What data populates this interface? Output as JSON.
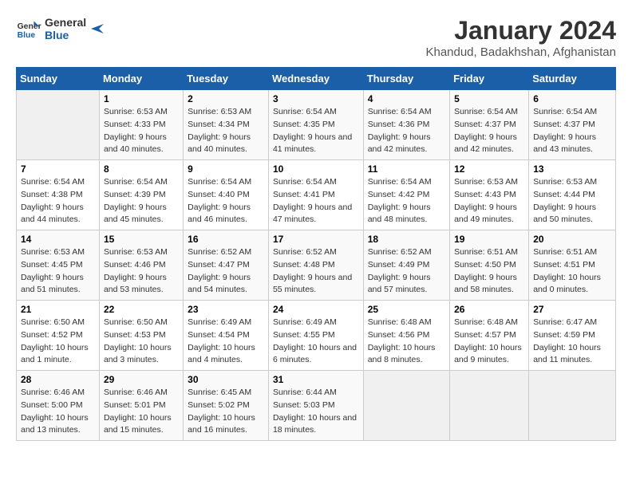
{
  "header": {
    "logo_line1": "General",
    "logo_line2": "Blue",
    "title": "January 2024",
    "subtitle": "Khandud, Badakhshan, Afghanistan"
  },
  "days_of_week": [
    "Sunday",
    "Monday",
    "Tuesday",
    "Wednesday",
    "Thursday",
    "Friday",
    "Saturday"
  ],
  "weeks": [
    [
      {
        "num": "",
        "empty": true
      },
      {
        "num": "1",
        "sunrise": "6:53 AM",
        "sunset": "4:33 PM",
        "daylight": "9 hours and 40 minutes."
      },
      {
        "num": "2",
        "sunrise": "6:53 AM",
        "sunset": "4:34 PM",
        "daylight": "9 hours and 40 minutes."
      },
      {
        "num": "3",
        "sunrise": "6:54 AM",
        "sunset": "4:35 PM",
        "daylight": "9 hours and 41 minutes."
      },
      {
        "num": "4",
        "sunrise": "6:54 AM",
        "sunset": "4:36 PM",
        "daylight": "9 hours and 42 minutes."
      },
      {
        "num": "5",
        "sunrise": "6:54 AM",
        "sunset": "4:37 PM",
        "daylight": "9 hours and 42 minutes."
      },
      {
        "num": "6",
        "sunrise": "6:54 AM",
        "sunset": "4:37 PM",
        "daylight": "9 hours and 43 minutes."
      }
    ],
    [
      {
        "num": "7",
        "sunrise": "6:54 AM",
        "sunset": "4:38 PM",
        "daylight": "9 hours and 44 minutes."
      },
      {
        "num": "8",
        "sunrise": "6:54 AM",
        "sunset": "4:39 PM",
        "daylight": "9 hours and 45 minutes."
      },
      {
        "num": "9",
        "sunrise": "6:54 AM",
        "sunset": "4:40 PM",
        "daylight": "9 hours and 46 minutes."
      },
      {
        "num": "10",
        "sunrise": "6:54 AM",
        "sunset": "4:41 PM",
        "daylight": "9 hours and 47 minutes."
      },
      {
        "num": "11",
        "sunrise": "6:54 AM",
        "sunset": "4:42 PM",
        "daylight": "9 hours and 48 minutes."
      },
      {
        "num": "12",
        "sunrise": "6:53 AM",
        "sunset": "4:43 PM",
        "daylight": "9 hours and 49 minutes."
      },
      {
        "num": "13",
        "sunrise": "6:53 AM",
        "sunset": "4:44 PM",
        "daylight": "9 hours and 50 minutes."
      }
    ],
    [
      {
        "num": "14",
        "sunrise": "6:53 AM",
        "sunset": "4:45 PM",
        "daylight": "9 hours and 51 minutes."
      },
      {
        "num": "15",
        "sunrise": "6:53 AM",
        "sunset": "4:46 PM",
        "daylight": "9 hours and 53 minutes."
      },
      {
        "num": "16",
        "sunrise": "6:52 AM",
        "sunset": "4:47 PM",
        "daylight": "9 hours and 54 minutes."
      },
      {
        "num": "17",
        "sunrise": "6:52 AM",
        "sunset": "4:48 PM",
        "daylight": "9 hours and 55 minutes."
      },
      {
        "num": "18",
        "sunrise": "6:52 AM",
        "sunset": "4:49 PM",
        "daylight": "9 hours and 57 minutes."
      },
      {
        "num": "19",
        "sunrise": "6:51 AM",
        "sunset": "4:50 PM",
        "daylight": "9 hours and 58 minutes."
      },
      {
        "num": "20",
        "sunrise": "6:51 AM",
        "sunset": "4:51 PM",
        "daylight": "10 hours and 0 minutes."
      }
    ],
    [
      {
        "num": "21",
        "sunrise": "6:50 AM",
        "sunset": "4:52 PM",
        "daylight": "10 hours and 1 minute."
      },
      {
        "num": "22",
        "sunrise": "6:50 AM",
        "sunset": "4:53 PM",
        "daylight": "10 hours and 3 minutes."
      },
      {
        "num": "23",
        "sunrise": "6:49 AM",
        "sunset": "4:54 PM",
        "daylight": "10 hours and 4 minutes."
      },
      {
        "num": "24",
        "sunrise": "6:49 AM",
        "sunset": "4:55 PM",
        "daylight": "10 hours and 6 minutes."
      },
      {
        "num": "25",
        "sunrise": "6:48 AM",
        "sunset": "4:56 PM",
        "daylight": "10 hours and 8 minutes."
      },
      {
        "num": "26",
        "sunrise": "6:48 AM",
        "sunset": "4:57 PM",
        "daylight": "10 hours and 9 minutes."
      },
      {
        "num": "27",
        "sunrise": "6:47 AM",
        "sunset": "4:59 PM",
        "daylight": "10 hours and 11 minutes."
      }
    ],
    [
      {
        "num": "28",
        "sunrise": "6:46 AM",
        "sunset": "5:00 PM",
        "daylight": "10 hours and 13 minutes."
      },
      {
        "num": "29",
        "sunrise": "6:46 AM",
        "sunset": "5:01 PM",
        "daylight": "10 hours and 15 minutes."
      },
      {
        "num": "30",
        "sunrise": "6:45 AM",
        "sunset": "5:02 PM",
        "daylight": "10 hours and 16 minutes."
      },
      {
        "num": "31",
        "sunrise": "6:44 AM",
        "sunset": "5:03 PM",
        "daylight": "10 hours and 18 minutes."
      },
      {
        "num": "",
        "empty": true
      },
      {
        "num": "",
        "empty": true
      },
      {
        "num": "",
        "empty": true
      }
    ]
  ],
  "labels": {
    "sunrise": "Sunrise:",
    "sunset": "Sunset:",
    "daylight": "Daylight:"
  }
}
